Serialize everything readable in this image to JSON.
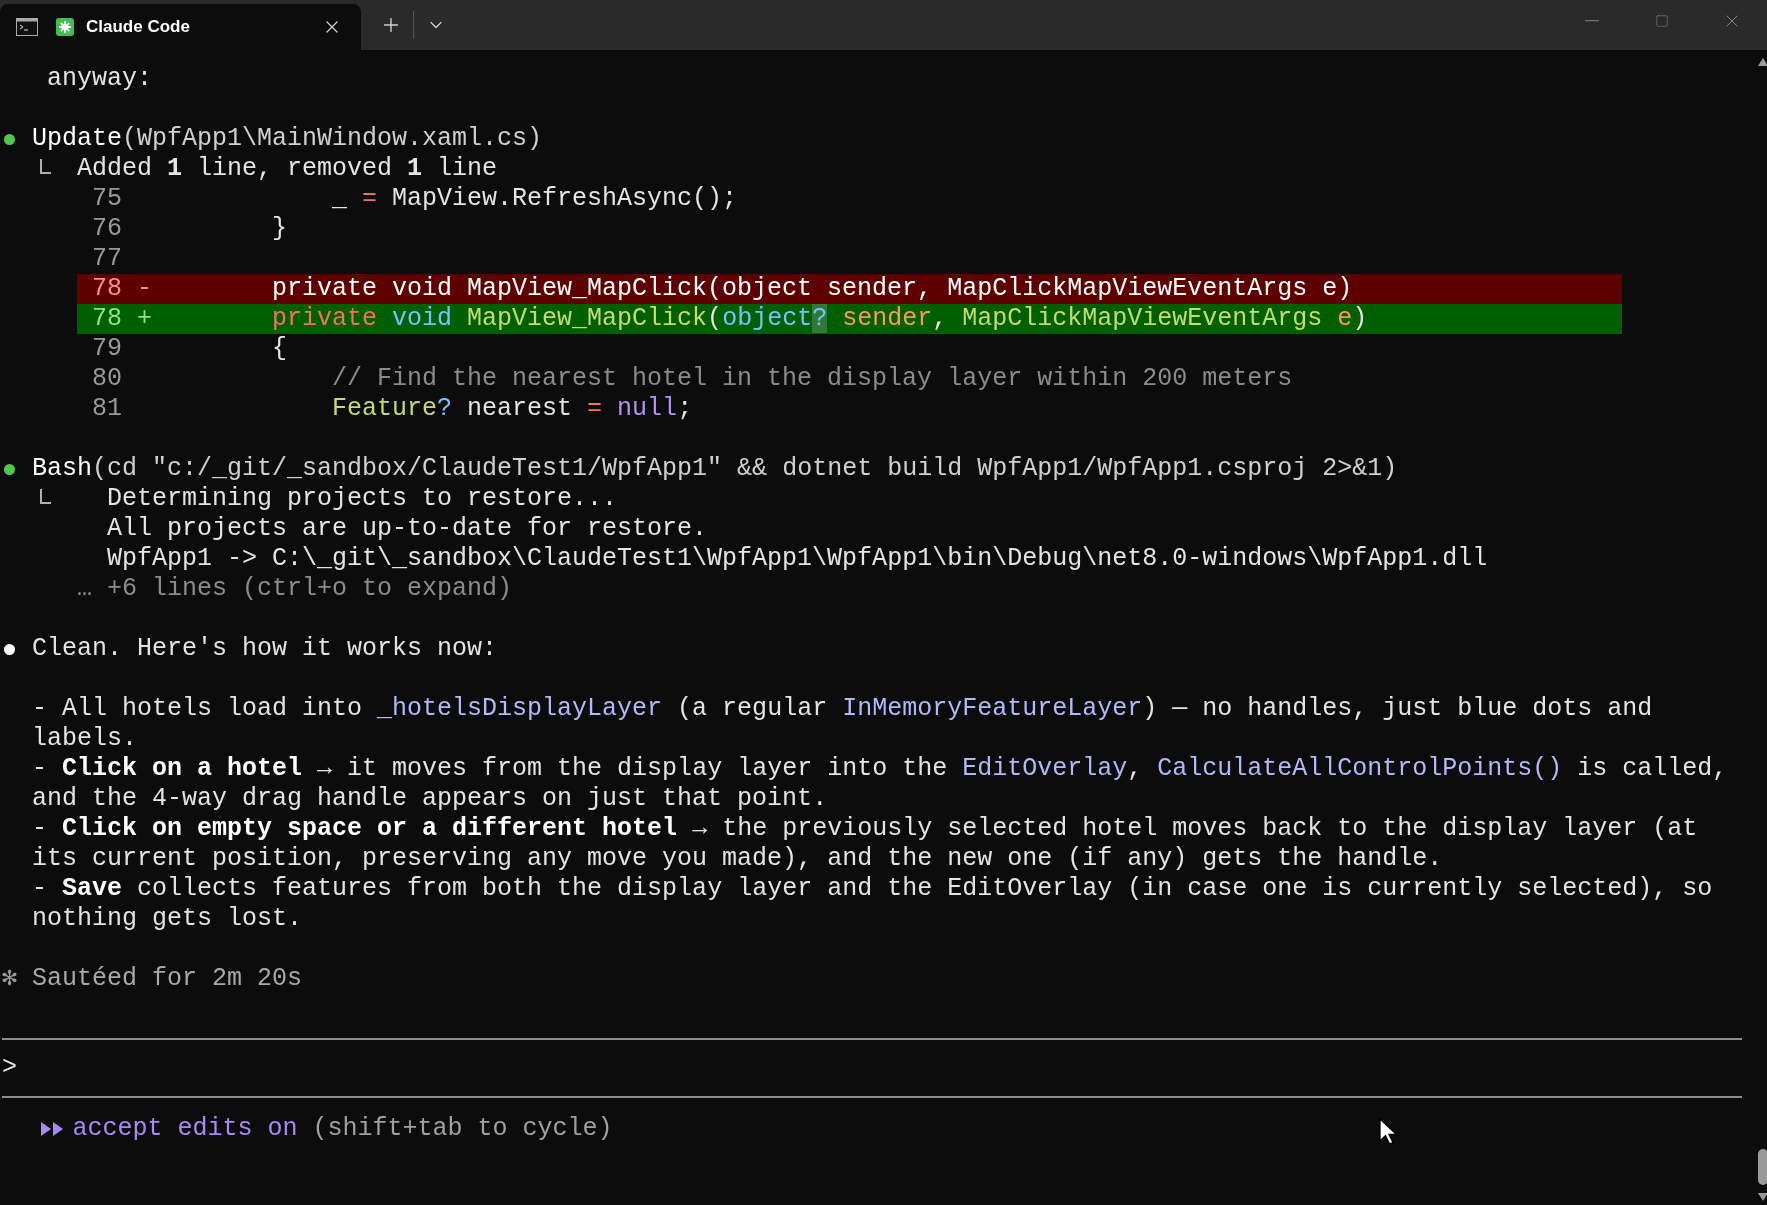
{
  "tab_bar": {
    "tabs": [
      {
        "title": "Claude Code",
        "selected": true
      }
    ]
  },
  "transcript": [
    {
      "kind": "continuation",
      "text": "anyway:"
    },
    {
      "kind": "tool",
      "color": "#4ec94e",
      "name": "Update",
      "args": "(WpfApp1\\MainWindow.xaml.cs)",
      "result": {
        "summary": "Added **1** line, removed **1** line",
        "diff": [
          {
            "kind": "context",
            "number": "75",
            "code": [
              {
                "text": "            _ ",
                "kind": "plain"
              },
              {
                "text": "=",
                "kind": "operator"
              },
              {
                "text": " MapView.RefreshAsync();",
                "kind": "plain"
              }
            ]
          },
          {
            "kind": "context",
            "number": "76",
            "code": [
              {
                "text": "        }",
                "kind": "plain"
              }
            ]
          },
          {
            "kind": "context",
            "number": "77"
          },
          {
            "kind": "removed",
            "number": "78",
            "sign": "-",
            "code": [
              {
                "text": "        private void MapView_MapClick(object sender, MapClickMapViewEventArgs e)",
                "kind": "plain"
              }
            ]
          },
          {
            "kind": "added",
            "number": "78",
            "sign": "+",
            "code": [
              {
                "text": "        private",
                "kind": "keyword"
              },
              {
                "text": " void",
                "kind": "builtin"
              },
              {
                "text": " MapView_MapClick",
                "kind": "name"
              },
              {
                "text": "(",
                "kind": "plain"
              },
              {
                "text": "object",
                "kind": "builtin"
              },
              {
                "text": "?",
                "kind": "highlight"
              },
              {
                "text": " sender",
                "kind": "param"
              },
              {
                "text": ", ",
                "kind": "plain"
              },
              {
                "text": "MapClickMapViewEventArgs",
                "kind": "name"
              },
              {
                "text": " e",
                "kind": "param"
              },
              {
                "text": ")",
                "kind": "plain"
              }
            ]
          },
          {
            "kind": "context",
            "number": "79",
            "code": [
              {
                "text": "        {",
                "kind": "plain"
              }
            ]
          },
          {
            "kind": "context",
            "number": "80",
            "code": [
              {
                "text": "            // Find the nearest hotel in the display layer within 200 meters",
                "kind": "comment"
              }
            ]
          },
          {
            "kind": "context",
            "number": "81",
            "code": [
              {
                "text": "            Feature",
                "kind": "name"
              },
              {
                "text": "?",
                "kind": "builtin"
              },
              {
                "text": " nearest ",
                "kind": "plain"
              },
              {
                "text": "=",
                "kind": "operator"
              },
              {
                "text": " null",
                "kind": "literal"
              },
              {
                "text": ";",
                "kind": "plain"
              }
            ]
          }
        ]
      }
    },
    {
      "kind": "tool",
      "color": "#4ec94e",
      "name": "Bash",
      "args": "(cd \"c:/_git/_sandbox/ClaudeTest1/WpfApp1\" && dotnet build WpfApp1/WpfApp1.csproj 2>&1)",
      "result": {
        "output": [
          "Determining projects to restore...",
          "All projects are up-to-date for restore.",
          "WpfApp1 -> C:\\_git\\_sandbox\\ClaudeTest1\\WpfApp1\\WpfApp1\\bin\\Debug\\net8.0-windows\\WpfApp1.dll"
        ],
        "more": "… +6 lines (ctrl+o to expand)"
      }
    },
    {
      "kind": "message",
      "color": "#ffffff",
      "text": "Clean. Here's how it works now:",
      "bullets": [
        [
          {
            "text": "- All hotels load into ",
            "kind": "plain"
          },
          {
            "text": "_hotelsDisplayLayer",
            "kind": "code"
          },
          {
            "text": " (a regular ",
            "kind": "plain"
          },
          {
            "text": "InMemoryFeatureLayer",
            "kind": "code"
          },
          {
            "text": ") — no handles, just blue dots and labels.",
            "kind": "plain"
          }
        ],
        [
          {
            "text": "- ",
            "kind": "plain"
          },
          {
            "text": "Click on a hotel",
            "kind": "bold"
          },
          {
            "text": " → it moves from the display layer into the ",
            "kind": "plain"
          },
          {
            "text": "EditOverlay",
            "kind": "code"
          },
          {
            "text": ", ",
            "kind": "plain"
          },
          {
            "text": "CalculateAllControlPoints()",
            "kind": "code"
          },
          {
            "text": " is called, and the 4-way drag handle appears on just that point.",
            "kind": "plain"
          }
        ],
        [
          {
            "text": "- ",
            "kind": "plain"
          },
          {
            "text": "Click on empty space or a different hotel",
            "kind": "bold"
          },
          {
            "text": " → the previously selected hotel moves back to the display layer (at its current position, preserving any move you made), and the new one (if any) gets the handle.",
            "kind": "plain"
          }
        ],
        [
          {
            "text": "- ",
            "kind": "plain"
          },
          {
            "text": "Save",
            "kind": "bold"
          },
          {
            "text": " collects features from both the display layer and the EditOverlay (in case one is currently selected), so nothing gets lost.",
            "kind": "plain"
          }
        ]
      ]
    },
    {
      "kind": "status",
      "spinner": "✻",
      "text": "Sautéed for 2m 20s"
    }
  ],
  "prompt": {
    "symbol": ">"
  },
  "mode": {
    "label": "accept edits on",
    "hint": "(shift+tab to cycle)"
  }
}
